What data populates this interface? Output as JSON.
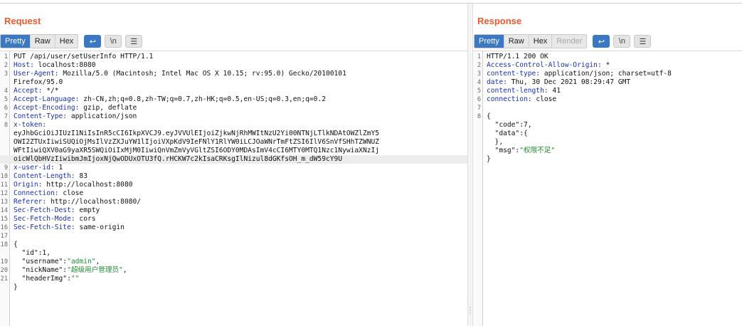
{
  "request": {
    "title": "Request",
    "tabs": [
      "Pretty",
      "Raw",
      "Hex"
    ],
    "active_tab": "Pretty",
    "icons": [
      {
        "name": "wrap-lines-icon",
        "glyph": "↩",
        "active": true
      },
      {
        "name": "show-newlines-icon",
        "glyph": "\\n",
        "active": false
      },
      {
        "name": "menu-icon",
        "glyph": "☰",
        "active": false
      }
    ],
    "lines": [
      {
        "num": "1",
        "parts": [
          {
            "t": "PUT /api/user/setUserInfo HTTP/1.1",
            "c": ""
          }
        ]
      },
      {
        "num": "2",
        "parts": [
          {
            "t": "Host:",
            "c": "k"
          },
          {
            "t": " localhost:8080",
            "c": ""
          }
        ]
      },
      {
        "num": "3",
        "parts": [
          {
            "t": "User-Agent:",
            "c": "k"
          },
          {
            "t": " Mozilla/5.0 (Macintosh; Intel Mac OS X 10.15; rv:95.0) Gecko/20100101",
            "c": ""
          }
        ]
      },
      {
        "num": "",
        "parts": [
          {
            "t": "Firefox/95.0",
            "c": ""
          }
        ]
      },
      {
        "num": "4",
        "parts": [
          {
            "t": "Accept:",
            "c": "k"
          },
          {
            "t": " */*",
            "c": ""
          }
        ]
      },
      {
        "num": "5",
        "parts": [
          {
            "t": "Accept-Language:",
            "c": "k"
          },
          {
            "t": " zh-CN,zh;q=0.8,zh-TW;q=0.7,zh-HK;q=0.5,en-US;q=0.3,en;q=0.2",
            "c": ""
          }
        ]
      },
      {
        "num": "6",
        "parts": [
          {
            "t": "Accept-Encoding:",
            "c": "k"
          },
          {
            "t": " gzip, deflate",
            "c": ""
          }
        ]
      },
      {
        "num": "7",
        "parts": [
          {
            "t": "Content-Type:",
            "c": "k"
          },
          {
            "t": " application/json",
            "c": ""
          }
        ]
      },
      {
        "num": "8",
        "parts": [
          {
            "t": "x-token:",
            "c": "k"
          }
        ]
      },
      {
        "num": "",
        "parts": [
          {
            "t": "eyJhbGciOiJIUzI1NiIsInR5cCI6IkpXVCJ9.eyJVVUlEIjoiZjkwNjRhMWItNzU2Yi00NTNjLTlkNDAtOWZlZmY5",
            "c": ""
          }
        ]
      },
      {
        "num": "",
        "parts": [
          {
            "t": "OWI2ZTUxIiwiSUQiOjMsIlVzZXJuYW1lIjoiVXpKdV9IeFNlY1RlYW0iLCJOaWNrTmFtZSI6IlV6SnVfSHhTZWNUZ",
            "c": ""
          }
        ]
      },
      {
        "num": "",
        "parts": [
          {
            "t": "WFtIiwiQXV0aG9yaXR5SWQiOiIxMjM0IiwiQnVmZmVyVGltZSI6ODY0MDAsImV4cCI6MTY0MTQ1Nzc1NywiaXNzIj",
            "c": ""
          }
        ]
      },
      {
        "num": "",
        "hl": true,
        "parts": [
          {
            "t": "oicWlQbHVzIiwibmJmIjoxNjQwODUxOTU3fQ.rHCKW7c2kIsaCRKsgIlNizul8dGKfsOH_m_dW59cY9U",
            "c": ""
          }
        ]
      },
      {
        "num": "9",
        "parts": [
          {
            "t": "x-user-id:",
            "c": "k"
          },
          {
            "t": " 1",
            "c": ""
          }
        ]
      },
      {
        "num": "10",
        "parts": [
          {
            "t": "Content-Length:",
            "c": "k"
          },
          {
            "t": " 83",
            "c": ""
          }
        ]
      },
      {
        "num": "11",
        "parts": [
          {
            "t": "Origin:",
            "c": "k"
          },
          {
            "t": " http://localhost:8080",
            "c": ""
          }
        ]
      },
      {
        "num": "12",
        "parts": [
          {
            "t": "Connection:",
            "c": "k"
          },
          {
            "t": " close",
            "c": ""
          }
        ]
      },
      {
        "num": "13",
        "parts": [
          {
            "t": "Referer:",
            "c": "k"
          },
          {
            "t": " http://localhost:8080/",
            "c": ""
          }
        ]
      },
      {
        "num": "14",
        "parts": [
          {
            "t": "Sec-Fetch-Dest:",
            "c": "k"
          },
          {
            "t": " empty",
            "c": ""
          }
        ]
      },
      {
        "num": "15",
        "parts": [
          {
            "t": "Sec-Fetch-Mode:",
            "c": "k"
          },
          {
            "t": " cors",
            "c": ""
          }
        ]
      },
      {
        "num": "16",
        "parts": [
          {
            "t": "Sec-Fetch-Site:",
            "c": "k"
          },
          {
            "t": " same-origin",
            "c": ""
          }
        ]
      },
      {
        "num": "17",
        "parts": []
      },
      {
        "num": "18",
        "parts": [
          {
            "t": "{",
            "c": ""
          }
        ]
      },
      {
        "num": "",
        "parts": [
          {
            "t": "  \"id\":1,",
            "c": ""
          }
        ]
      },
      {
        "num": "19",
        "parts": [
          {
            "t": "  \"username\":",
            "c": ""
          },
          {
            "t": "\"admin\"",
            "c": "s"
          },
          {
            "t": ",",
            "c": ""
          }
        ]
      },
      {
        "num": "20",
        "parts": [
          {
            "t": "  \"nickName\":",
            "c": ""
          },
          {
            "t": "\"超级用户管理员\"",
            "c": "s"
          },
          {
            "t": ",",
            "c": ""
          }
        ]
      },
      {
        "num": "21",
        "parts": [
          {
            "t": "  \"headerImg\":",
            "c": ""
          },
          {
            "t": "\"\"",
            "c": "s"
          }
        ]
      },
      {
        "num": "",
        "parts": [
          {
            "t": "}",
            "c": ""
          }
        ]
      }
    ]
  },
  "response": {
    "title": "Response",
    "tabs": [
      "Pretty",
      "Raw",
      "Hex",
      "Render"
    ],
    "active_tab": "Pretty",
    "disabled_tabs": [
      "Render"
    ],
    "icons": [
      {
        "name": "wrap-lines-icon",
        "glyph": "↩",
        "active": true
      },
      {
        "name": "show-newlines-icon",
        "glyph": "\\n",
        "active": false
      },
      {
        "name": "menu-icon",
        "glyph": "☰",
        "active": false
      }
    ],
    "lines": [
      {
        "num": "1",
        "parts": [
          {
            "t": "HTTP/1.1 200 OK",
            "c": ""
          }
        ]
      },
      {
        "num": "2",
        "parts": [
          {
            "t": "Access-Control-Allow-Origin:",
            "c": "k"
          },
          {
            "t": " *",
            "c": ""
          }
        ]
      },
      {
        "num": "3",
        "parts": [
          {
            "t": "content-type:",
            "c": "k"
          },
          {
            "t": " application/json; charset=utf-8",
            "c": ""
          }
        ]
      },
      {
        "num": "4",
        "parts": [
          {
            "t": "date:",
            "c": "k"
          },
          {
            "t": " Thu, 30 Dec 2021 08:29:47 GMT",
            "c": ""
          }
        ]
      },
      {
        "num": "5",
        "parts": [
          {
            "t": "content-length:",
            "c": "k"
          },
          {
            "t": " 41",
            "c": ""
          }
        ]
      },
      {
        "num": "6",
        "parts": [
          {
            "t": "connection:",
            "c": "k"
          },
          {
            "t": " close",
            "c": ""
          }
        ]
      },
      {
        "num": "7",
        "parts": []
      },
      {
        "num": "8",
        "parts": [
          {
            "t": "{",
            "c": ""
          }
        ]
      },
      {
        "num": "",
        "parts": [
          {
            "t": "  \"code\":7,",
            "c": ""
          }
        ]
      },
      {
        "num": "",
        "parts": [
          {
            "t": "  \"data\":{",
            "c": ""
          }
        ]
      },
      {
        "num": "",
        "parts": [
          {
            "t": "  },",
            "c": ""
          }
        ]
      },
      {
        "num": "",
        "parts": [
          {
            "t": "  \"msg\":",
            "c": ""
          },
          {
            "t": "\"权限不足\"",
            "c": "s"
          }
        ]
      },
      {
        "num": "",
        "parts": [
          {
            "t": "}",
            "c": ""
          }
        ]
      }
    ]
  },
  "colors": {
    "title": "#e8592c",
    "active_tab": "#3a78c4",
    "header_key": "#1a2fb0",
    "string": "#1e8a2e"
  }
}
